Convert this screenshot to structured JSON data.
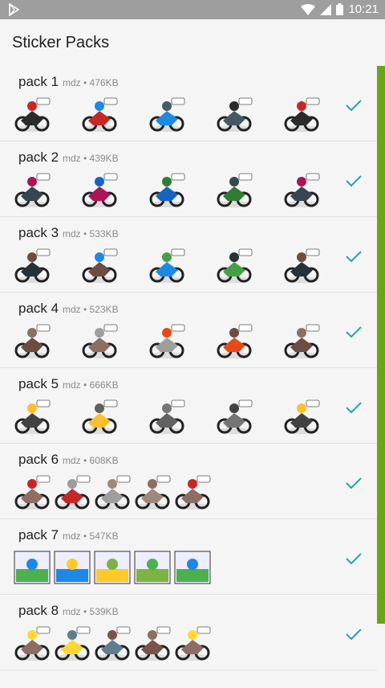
{
  "status_bar": {
    "time": "10:21"
  },
  "app_bar": {
    "title": "Sticker Packs"
  },
  "packs": [
    {
      "name": "pack 1",
      "meta": "mdz • 476KB"
    },
    {
      "name": "pack 2",
      "meta": "mdz • 439KB"
    },
    {
      "name": "pack 3",
      "meta": "mdz • 533KB"
    },
    {
      "name": "pack 4",
      "meta": "mdz • 523KB"
    },
    {
      "name": "pack 5",
      "meta": "mdz • 666KB"
    },
    {
      "name": "pack 6",
      "meta": "mdz • 608KB"
    },
    {
      "name": "pack 7",
      "meta": "mdz • 547KB"
    },
    {
      "name": "pack 8",
      "meta": "mdz • 539KB"
    }
  ],
  "colors": {
    "accent": "#26a69a",
    "scrollbar": "#6aa515",
    "status_bar": "#9e9e9e"
  },
  "icons": {
    "added": "check-icon"
  }
}
